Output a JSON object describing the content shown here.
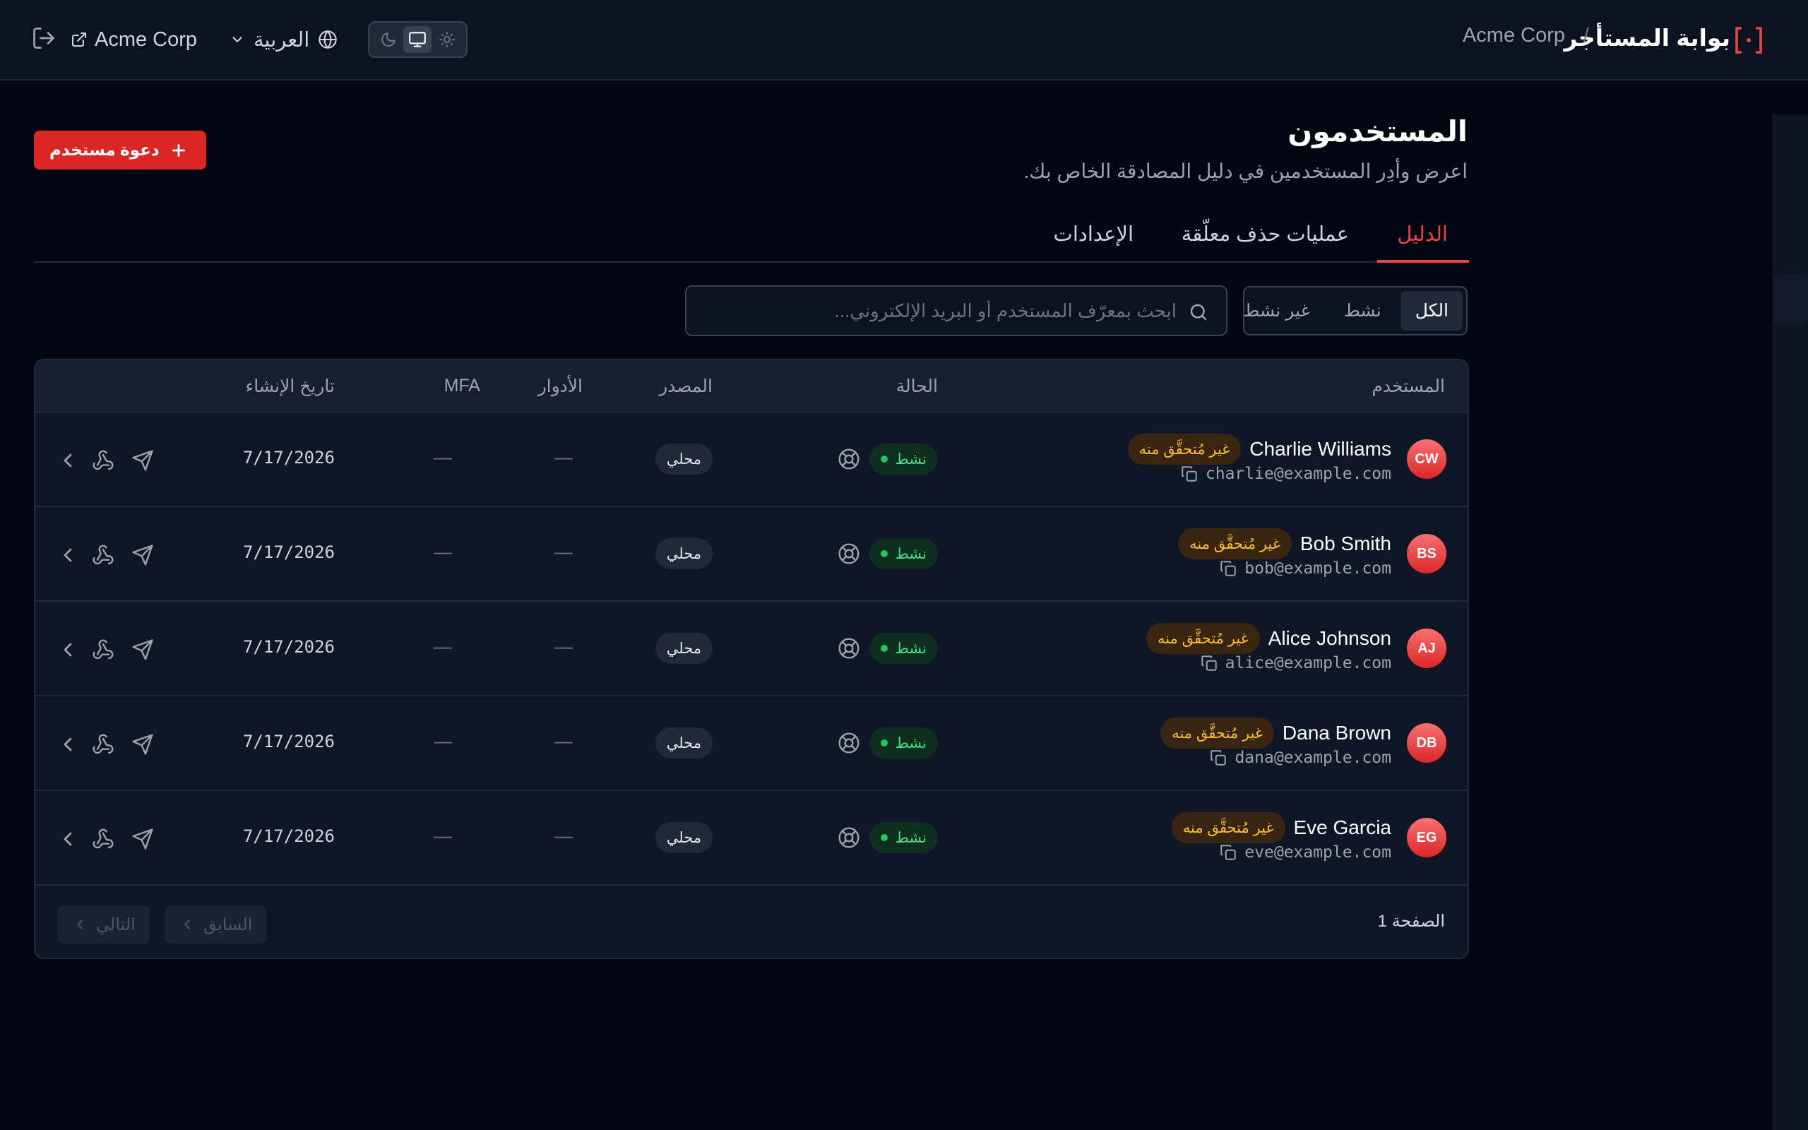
{
  "header": {
    "title": "بوابة المستأجر",
    "separator": "/",
    "org": "Acme Corp",
    "org_link": "Acme Corp",
    "language": "العربية",
    "theme_options": [
      "dark",
      "system",
      "light"
    ],
    "theme_selected": "system"
  },
  "page": {
    "title": "المستخدمون",
    "subtitle": "اعرض وأدِر المستخدمين في دليل المصادقة الخاص بك.",
    "invite_label": "دعوة مستخدم"
  },
  "tabs": [
    {
      "label": "الدليل",
      "active": true
    },
    {
      "label": "عمليات حذف معلّقة",
      "active": false
    },
    {
      "label": "الإعدادات",
      "active": false
    }
  ],
  "filter": {
    "options": [
      "الكل",
      "نشط",
      "غير نشط"
    ],
    "selected": "الكل"
  },
  "search": {
    "placeholder": "ابحث بمعرّف المستخدم أو البريد الإلكتروني...",
    "value": ""
  },
  "table": {
    "columns": {
      "user": "المستخدم",
      "status": "الحالة",
      "source": "المصدر",
      "roles": "الأدوار",
      "mfa": "MFA",
      "created": "تاريخ الإنشاء"
    },
    "rows": [
      {
        "initials": "CW",
        "name": "Charlie Williams",
        "badge": "غير مُتحقَّق منه",
        "email": "charlie@example.com",
        "status": "نشط",
        "source": "محلي",
        "roles": "—",
        "mfa": "—",
        "created": "7/17/2026"
      },
      {
        "initials": "BS",
        "name": "Bob Smith",
        "badge": "غير مُتحقَّق منه",
        "email": "bob@example.com",
        "status": "نشط",
        "source": "محلي",
        "roles": "—",
        "mfa": "—",
        "created": "7/17/2026"
      },
      {
        "initials": "AJ",
        "name": "Alice Johnson",
        "badge": "غير مُتحقَّق منه",
        "email": "alice@example.com",
        "status": "نشط",
        "source": "محلي",
        "roles": "—",
        "mfa": "—",
        "created": "7/17/2026"
      },
      {
        "initials": "DB",
        "name": "Dana Brown",
        "badge": "غير مُتحقَّق منه",
        "email": "dana@example.com",
        "status": "نشط",
        "source": "محلي",
        "roles": "—",
        "mfa": "—",
        "created": "7/17/2026"
      },
      {
        "initials": "EG",
        "name": "Eve Garcia",
        "badge": "غير مُتحقَّق منه",
        "email": "eve@example.com",
        "status": "نشط",
        "source": "محلي",
        "roles": "—",
        "mfa": "—",
        "created": "7/17/2026"
      }
    ]
  },
  "pagination": {
    "page_label": "الصفحة 1",
    "prev_label": "السابق",
    "next_label": "التالي"
  },
  "colors": {
    "accent": "#ef4444",
    "background": "#030712",
    "success": "#22c55e",
    "warning": "#fbbf24"
  },
  "icons": {
    "brand": "bracket-dot-icon",
    "logout": "logout-icon",
    "external": "external-link-icon",
    "language": "globe-icon",
    "theme": [
      "moon-icon",
      "monitor-icon",
      "sun-icon"
    ],
    "search": "search-icon",
    "copy": "copy-icon",
    "row_actions": [
      "send-icon",
      "webhook-icon",
      "chevron-left-icon"
    ]
  }
}
